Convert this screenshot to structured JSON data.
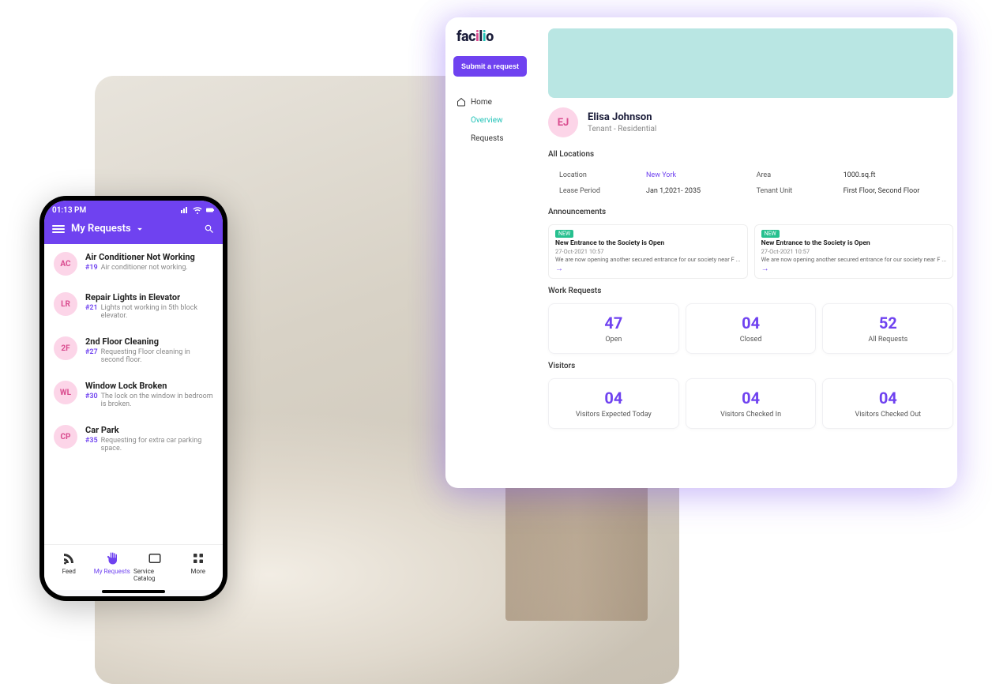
{
  "phone": {
    "time": "01:13 PM",
    "header": "My Requests",
    "requests": [
      {
        "badge": "AC",
        "title": "Air Conditioner Not Working",
        "num": "#19",
        "desc": "Air conditioner not working."
      },
      {
        "badge": "LR",
        "title": "Repair Lights in Elevator",
        "num": "#21",
        "desc": "Lights not working in 5th block elevator."
      },
      {
        "badge": "2F",
        "title": "2nd Floor Cleaning",
        "num": "#27",
        "desc": "Requesting Floor cleaning in second floor."
      },
      {
        "badge": "WL",
        "title": "Window Lock Broken",
        "num": "#30",
        "desc": "The lock on the window in bedroom is broken."
      },
      {
        "badge": "CP",
        "title": "Car Park",
        "num": "#35",
        "desc": "Requesting for extra car parking space."
      }
    ],
    "tabs": {
      "feed": "Feed",
      "my_requests": "My Requests",
      "service_catalog": "Service Catalog",
      "more": "More"
    }
  },
  "desktop": {
    "logo": "facilio",
    "submit_label": "Submit a request",
    "nav": {
      "home": "Home",
      "overview": "Overview",
      "requests": "Requests"
    },
    "profile": {
      "initials": "EJ",
      "name": "Elisa Johnson",
      "role": "Tenant - Residential"
    },
    "all_locations_title": "All Locations",
    "info": {
      "location_label": "Location",
      "location_value": "New York",
      "area_label": "Area",
      "area_value": "1000.sq.ft",
      "lease_label": "Lease Period",
      "lease_value": "Jan 1,2021- 2035",
      "unit_label": "Tenant Unit",
      "unit_value": "First Floor, Second Floor"
    },
    "announcements_title": "Announcements",
    "announcements": [
      {
        "new": "NEW",
        "title": "New Entrance to the Society is Open",
        "date": "27-Oct-2021 10:57",
        "body": "We are now opening another secured entrance for our society near F ..."
      },
      {
        "new": "NEW",
        "title": "New Entrance to the Society is Open",
        "date": "27-Oct-2021 10:57",
        "body": "We are now opening another secured entrance for our society near F ..."
      }
    ],
    "work_requests_title": "Work Requests",
    "work_stats": [
      {
        "value": "47",
        "label": "Open"
      },
      {
        "value": "04",
        "label": "Closed"
      },
      {
        "value": "52",
        "label": "All Requests"
      }
    ],
    "visitors_title": "Visitors",
    "visitor_stats": [
      {
        "value": "04",
        "label": "Visitors Expected Today"
      },
      {
        "value": "04",
        "label": "Visitors Checked In"
      },
      {
        "value": "04",
        "label": "Visitors Checked Out"
      }
    ]
  }
}
